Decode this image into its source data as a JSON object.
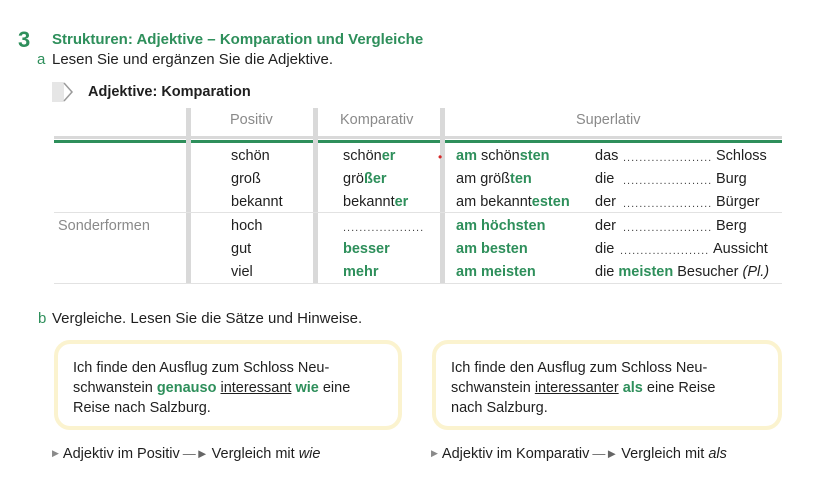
{
  "section": {
    "number": "3",
    "title": "Strukturen: Adjektive – Komparation und Vergleiche"
  },
  "part_a": {
    "letter": "a",
    "instruction": "Lesen Sie und ergänzen Sie die Adjektive.",
    "table_title": "Adjektive: Komparation",
    "headers": {
      "positiv": "Positiv",
      "komparativ": "Komparativ",
      "superlativ": "Superlativ"
    },
    "sonderformen_label": "Sonderformen",
    "rows": [
      {
        "positiv": "schön",
        "komp_stem": "schön",
        "komp_end": "er",
        "sup_pre": "am",
        "sup_stem": "schön",
        "sup_end": "sten",
        "sup_green_am": true,
        "art": "das",
        "dots": "......................",
        "noun": "Schloss"
      },
      {
        "positiv": "groß",
        "komp_stem": "grö",
        "komp_end": "ßer",
        "sup_pre": "am",
        "sup_stem": "größ",
        "sup_end": "ten",
        "art": "die",
        "dots": "......................",
        "noun": "Burg"
      },
      {
        "positiv": "bekannt",
        "komp_stem": "bekannt",
        "komp_end": "er",
        "sup_pre": "am",
        "sup_stem": "bekannt",
        "sup_end": "esten",
        "art": "der",
        "dots": "......................",
        "noun": "Bürger"
      },
      {
        "positiv": "hoch",
        "komp_blank": "....................",
        "sup_full": "am höchsten",
        "art": "der",
        "dots": "......................",
        "noun": "Berg"
      },
      {
        "positiv": "gut",
        "komp_full": "besser",
        "sup_full": "am besten",
        "art": "die",
        "dots": "......................",
        "noun": "Aussicht"
      },
      {
        "positiv": "viel",
        "komp_full": "mehr",
        "sup_full": "am meisten",
        "art": "die",
        "mid": "meisten",
        "noun": "Besucher",
        "note": "(Pl.)"
      }
    ]
  },
  "part_b": {
    "letter": "b",
    "instruction": "Vergleiche. Lesen Sie die Sätze und Hinweise.",
    "box_left": {
      "t1": "Ich finde den Ausflug zum Schloss Neu-",
      "t2": "schwanstein ",
      "k1": "genauso",
      "t3": " ",
      "u1": "interessant",
      "t4": " ",
      "k2": "wie",
      "t5": " eine",
      "t6": "Reise nach Salzburg."
    },
    "box_right": {
      "t1": "Ich finde den Ausflug zum Schloss Neu-",
      "t2": "schwanstein ",
      "u1": "interessanter",
      "t3": " ",
      "k1": "als",
      "t4": " eine Reise",
      "t5": "nach Salzburg."
    },
    "note_left": {
      "a": "Adjektiv im Positiv",
      "b": "Vergleich mit",
      "c": "wie"
    },
    "note_right": {
      "a": "Adjektiv im Komparativ",
      "b": "Vergleich mit",
      "c": "als"
    }
  },
  "colors": {
    "accent": "#2e8f5b",
    "box_border": "#fbf3cf",
    "header_grey": "#8a8a8a",
    "marker": "#d62828"
  }
}
